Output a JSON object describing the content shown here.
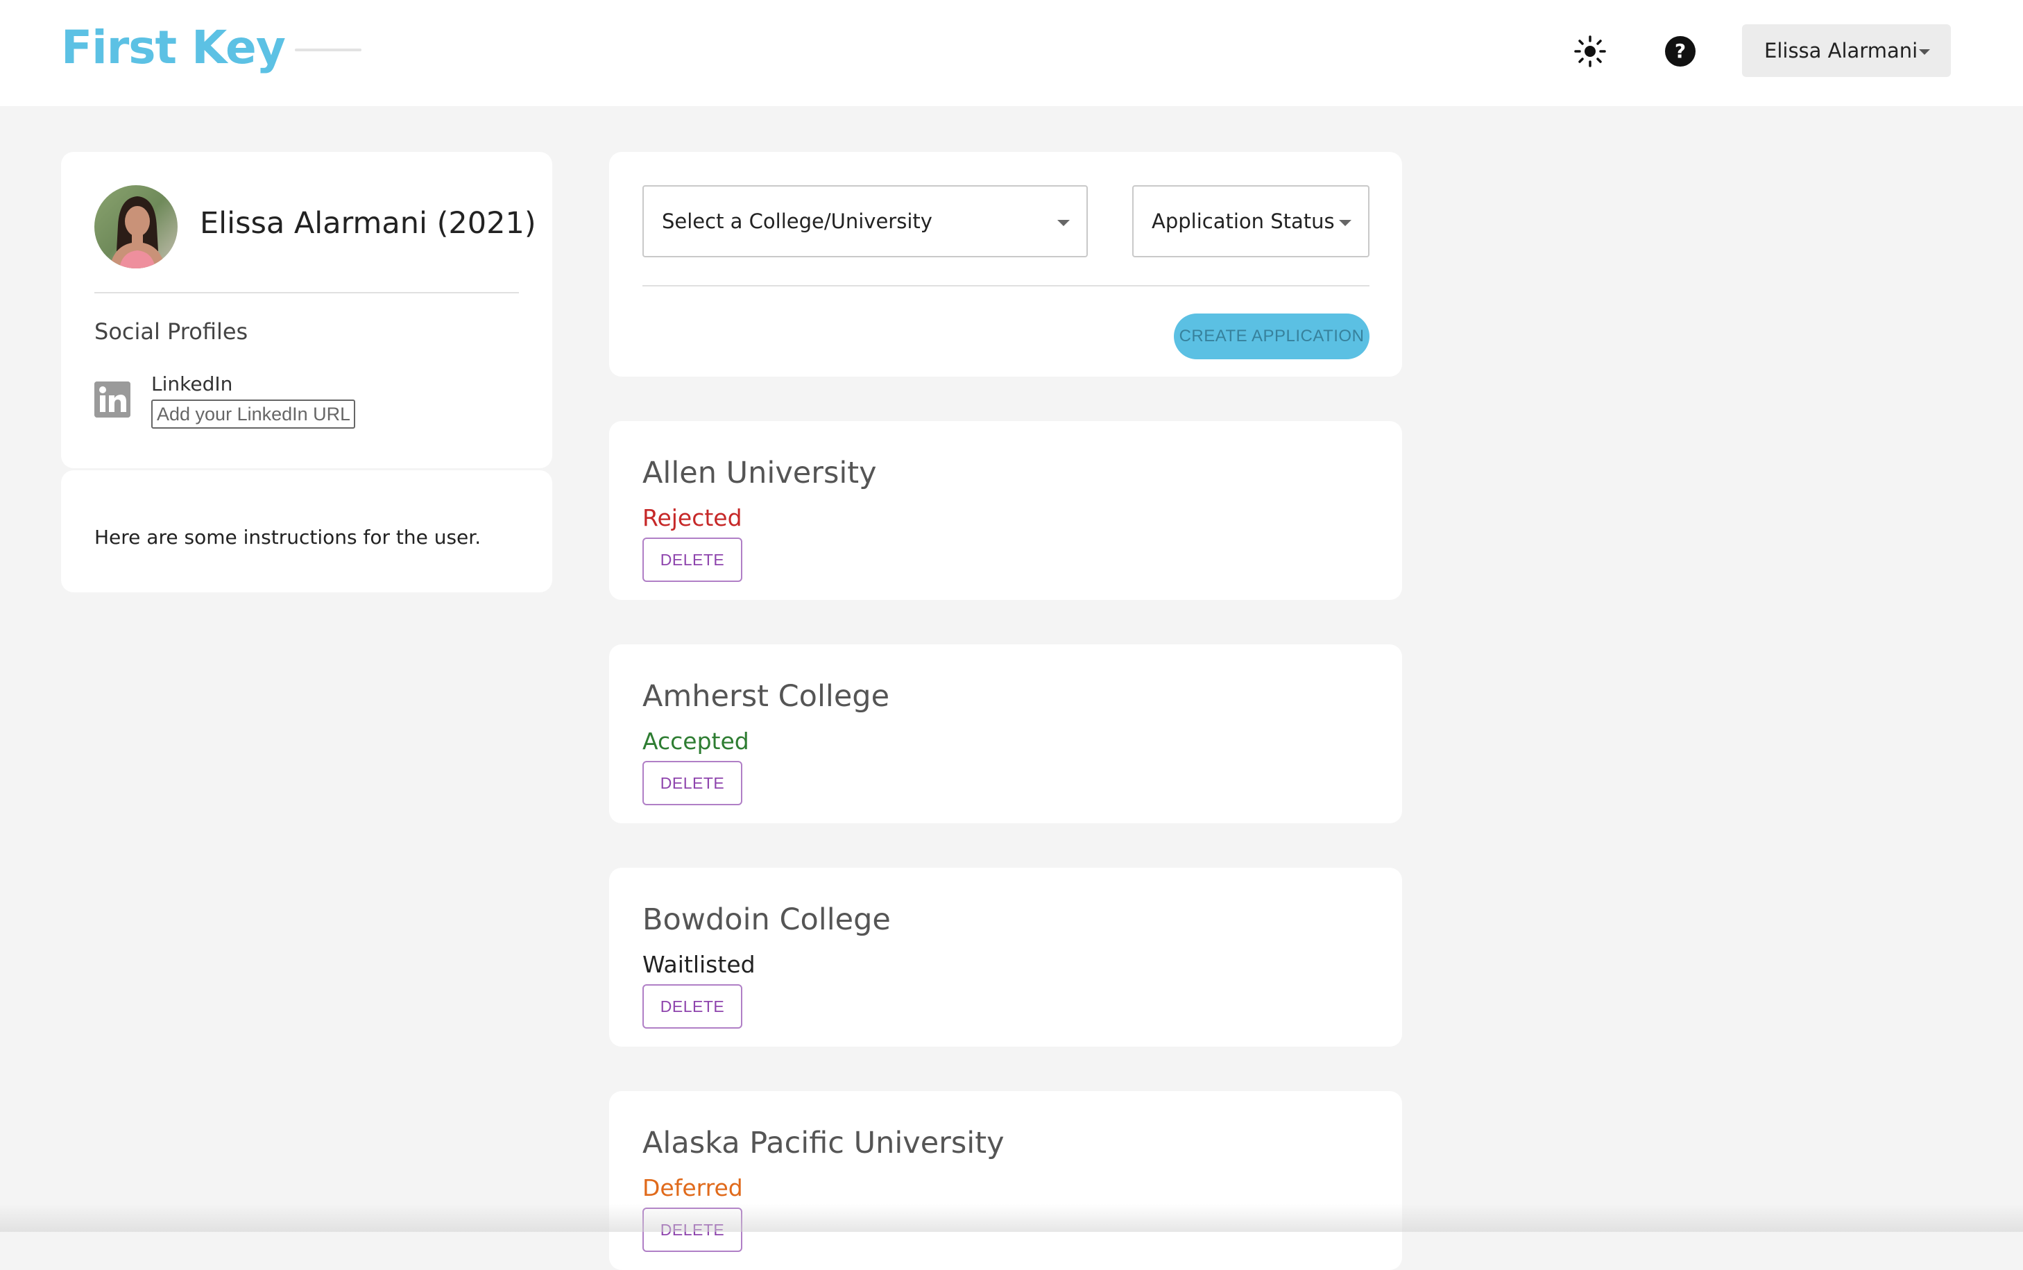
{
  "header": {
    "logo": "First Key",
    "user_menu_label": "Elissa Alarmani",
    "icons": [
      "sun-icon",
      "help-icon"
    ]
  },
  "profile": {
    "name": "Elissa Alarmani (2021)",
    "social_title": "Social Profiles",
    "linkedin_label": "LinkedIn",
    "linkedin_placeholder": "Add your LinkedIn URL"
  },
  "instructions": {
    "text": "Here are some instructions for the user."
  },
  "filters": {
    "college_select": "Select a College/University",
    "status_select": "Application Status",
    "create_label": "CREATE APPLICATION"
  },
  "applications": [
    {
      "name": "Allen University",
      "status": "Rejected",
      "status_color": "#c62828",
      "delete_label": "DELETE"
    },
    {
      "name": "Amherst College",
      "status": "Accepted",
      "status_color": "#2e7d32",
      "delete_label": "DELETE"
    },
    {
      "name": "Bowdoin College",
      "status": "Waitlisted",
      "status_color": "#222222",
      "delete_label": "DELETE"
    },
    {
      "name": "Alaska Pacific University",
      "status": "Deferred",
      "status_color": "#e06a1b",
      "delete_label": "DELETE"
    }
  ],
  "colors": {
    "brand": "#5cc1e4",
    "delete": "#8e44ad"
  }
}
